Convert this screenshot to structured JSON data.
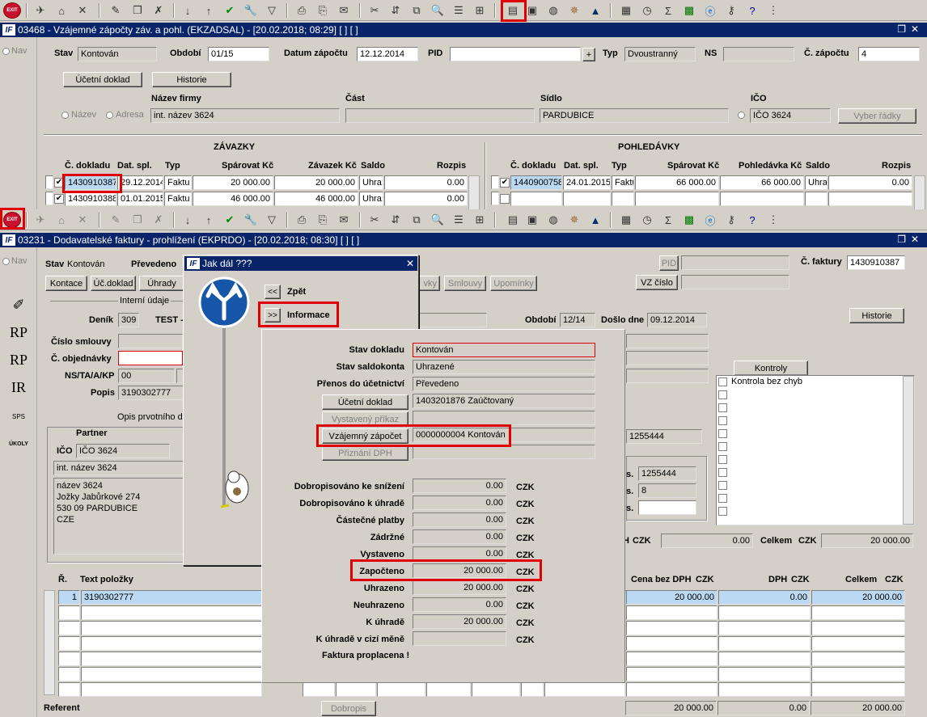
{
  "win1": {
    "title": "03468 - Vzájemné zápočty záv. a pohl. (EKZADSAL) - [20.02.2018; 08:29]  [ ]  [ ]",
    "nav_label": "Nav",
    "stav_label": "Stav",
    "stav_value": "Kontován",
    "obdobi_label": "Období",
    "obdobi_value": "01/15",
    "datum_label": "Datum zápočtu",
    "datum_value": "12.12.2014",
    "pid_label": "PID",
    "pid_value": "",
    "plus": "+",
    "typ_label": "Typ",
    "typ_value": "Dvoustranný",
    "ns_label": "NS",
    "ns_value": "",
    "cislo_label": "Č. zápočtu",
    "cislo_value": "4",
    "btn_ucetni": "Účetní doklad",
    "btn_historie": "Historie",
    "nazev_firmy_label": "Název firmy",
    "cast_label": "Část",
    "sidlo_label": "Sídlo",
    "ico_label": "IČO",
    "radio_nazev": "Název",
    "radio_adresa": "Adresa",
    "nazev_value": "int. název 3624",
    "cast_value": "",
    "sidlo_value": "PARDUBICE",
    "ico_value": "IČO 3624",
    "btn_vyber": "Vyber řádky",
    "zavazky_title": "ZÁVAZKY",
    "pohledavky_title": "POHLEDÁVKY",
    "z_headers": [
      "Č. dokladu",
      "Dat. spl.",
      "Typ",
      "Spárovat Kč",
      "Závazek Kč",
      "Saldo",
      "Rozpis"
    ],
    "p_headers": [
      "Č. dokladu",
      "Dat. spl.",
      "Typ",
      "Spárovat Kč",
      "Pohledávka Kč",
      "Saldo",
      "Rozpis"
    ],
    "z_rows": [
      {
        "doc": "1430910387",
        "date": "29.12.2014",
        "typ": "Faktu",
        "sparovat": "20 000.00",
        "zavazek": "20 000.00",
        "saldo": "Uhra:",
        "rozpis": "0.00"
      },
      {
        "doc": "1430910388",
        "date": "01.01.2015",
        "typ": "Faktu",
        "sparovat": "46 000.00",
        "zavazek": "46 000.00",
        "saldo": "Uhra:",
        "rozpis": "0.00"
      }
    ],
    "p_rows": [
      {
        "doc": "1440900758",
        "date": "24.01.2015",
        "typ": "Faktu",
        "sparovat": "66 000.00",
        "pohledavka": "66 000.00",
        "saldo": "Uhra:",
        "rozpis": "0.00"
      }
    ]
  },
  "win2": {
    "title": "03231 - Dodavatelské faktury - prohlížení (EKPRDO) - [20.02.2018; 08:30]  [ ]  [ ]",
    "nav_label": "Nav",
    "stav_label": "Stav",
    "stav_value": "Kontován",
    "prevedeno_label": "Převedeno",
    "btn_kontace": "Kontace",
    "btn_ucdoklad": "Úč.doklad",
    "btn_uhrady": "Úhrady",
    "btn_vkky": "vky",
    "btn_smlouvy": "Smlouvy",
    "btn_upominky": "Upomínky",
    "pid_label": "PID",
    "cfak_label": "Č. faktury",
    "cfak_value": "1430910387",
    "btn_vzcislo": "VZ číslo",
    "interni": "Interní údaje",
    "denik_label": "Deník",
    "denik_value": "309",
    "test_label": "TEST -",
    "obdobi_label": "Období",
    "obdobi_value": "12/14",
    "doslo_label": "Došlo dne",
    "doslo_value": "09.12.2014",
    "btn_historie": "Historie",
    "cislo_smlouvy_label": "Číslo smlouvy",
    "c_objednavky_label": "Č. objednávky",
    "ns_label": "NS/TA/A/KP",
    "ns_value": "00",
    "popis_label": "Popis",
    "popis_value": "3190302777",
    "opis_label": "Opis prvotního d",
    "btn_kontroly": "Kontroly",
    "kontrola_text": "Kontrola bez chyb",
    "partner_label": "Partner",
    "ico_label": "IČO",
    "ico_value": "IČO 3624",
    "partner_name": "int. název 3624",
    "address": [
      "název 3624",
      "Jožky Jabůrkové 274",
      "530 09 PARDUBICE",
      "CZE"
    ],
    "val_1255444a": "1255444",
    "val_1255444b": "1255444",
    "val_8": "8",
    "s_label": "s.",
    "czk": "CZK",
    "total_czk_0": "0.00",
    "celkem_label": "Celkem",
    "total_celkem": "20 000.00",
    "r_header": "Ř.",
    "text_polozky": "Text položky",
    "cena_bez_dph": "Cena bez DPH",
    "dph": "DPH",
    "celkem": "Celkem",
    "item_no": "1",
    "item_text": "3190302777",
    "item_cena": "20 000.00",
    "item_dph": "0.00",
    "item_celkem": "20 000.00",
    "referent_label": "Referent",
    "btn_dobropis": "Dobropis",
    "foot_cena": "20 000.00",
    "foot_dph": "0.00",
    "foot_celkem": "20 000.00"
  },
  "dialog": {
    "title": "Jak dál ???",
    "back_btn": "<<",
    "back_label": "Zpět",
    "info_btn": ">>",
    "info_label": "Informace",
    "rows": [
      {
        "label": "Stav dokladu",
        "value": "Kontován"
      },
      {
        "label": "Stav saldokonta",
        "value": "Uhrazené"
      },
      {
        "label": "Přenos do účetnictví",
        "value": "Převedeno"
      }
    ],
    "btn_ucetni": "Účetní doklad",
    "ucetni_value": "1403201876 Zaúčtovaný",
    "btn_vystaveny": "Vystavený příkaz",
    "btn_vzajemny": "Vzájemný zápočet",
    "vzajemny_value": "0000000004 Kontován",
    "btn_priznani": "Přiznání DPH",
    "money_rows": [
      {
        "label": "Dobropisováno ke snížení",
        "value": "0.00",
        "cur": "CZK"
      },
      {
        "label": "Dobropisováno k úhradě",
        "value": "0.00",
        "cur": "CZK"
      },
      {
        "label": "Částečné platby",
        "value": "0.00",
        "cur": "CZK"
      },
      {
        "label": "Zádržné",
        "value": "0.00",
        "cur": "CZK"
      },
      {
        "label": "Vystaveno",
        "value": "0.00",
        "cur": "CZK"
      },
      {
        "label": "Započteno",
        "value": "20 000.00",
        "cur": "CZK"
      },
      {
        "label": "Uhrazeno",
        "value": "20 000.00",
        "cur": "CZK"
      },
      {
        "label": "Neuhrazeno",
        "value": "0.00",
        "cur": "CZK"
      },
      {
        "label": "K úhradě",
        "value": "20 000.00",
        "cur": "CZK"
      },
      {
        "label": "K úhradě v cizí měně",
        "value": "",
        "cur": "CZK"
      }
    ],
    "paid_text": "Faktura proplacena !"
  },
  "sidebar": [
    "RP",
    "RP",
    "IR",
    "SPS",
    "ÚKOLY"
  ],
  "exit_label": "EXIT"
}
